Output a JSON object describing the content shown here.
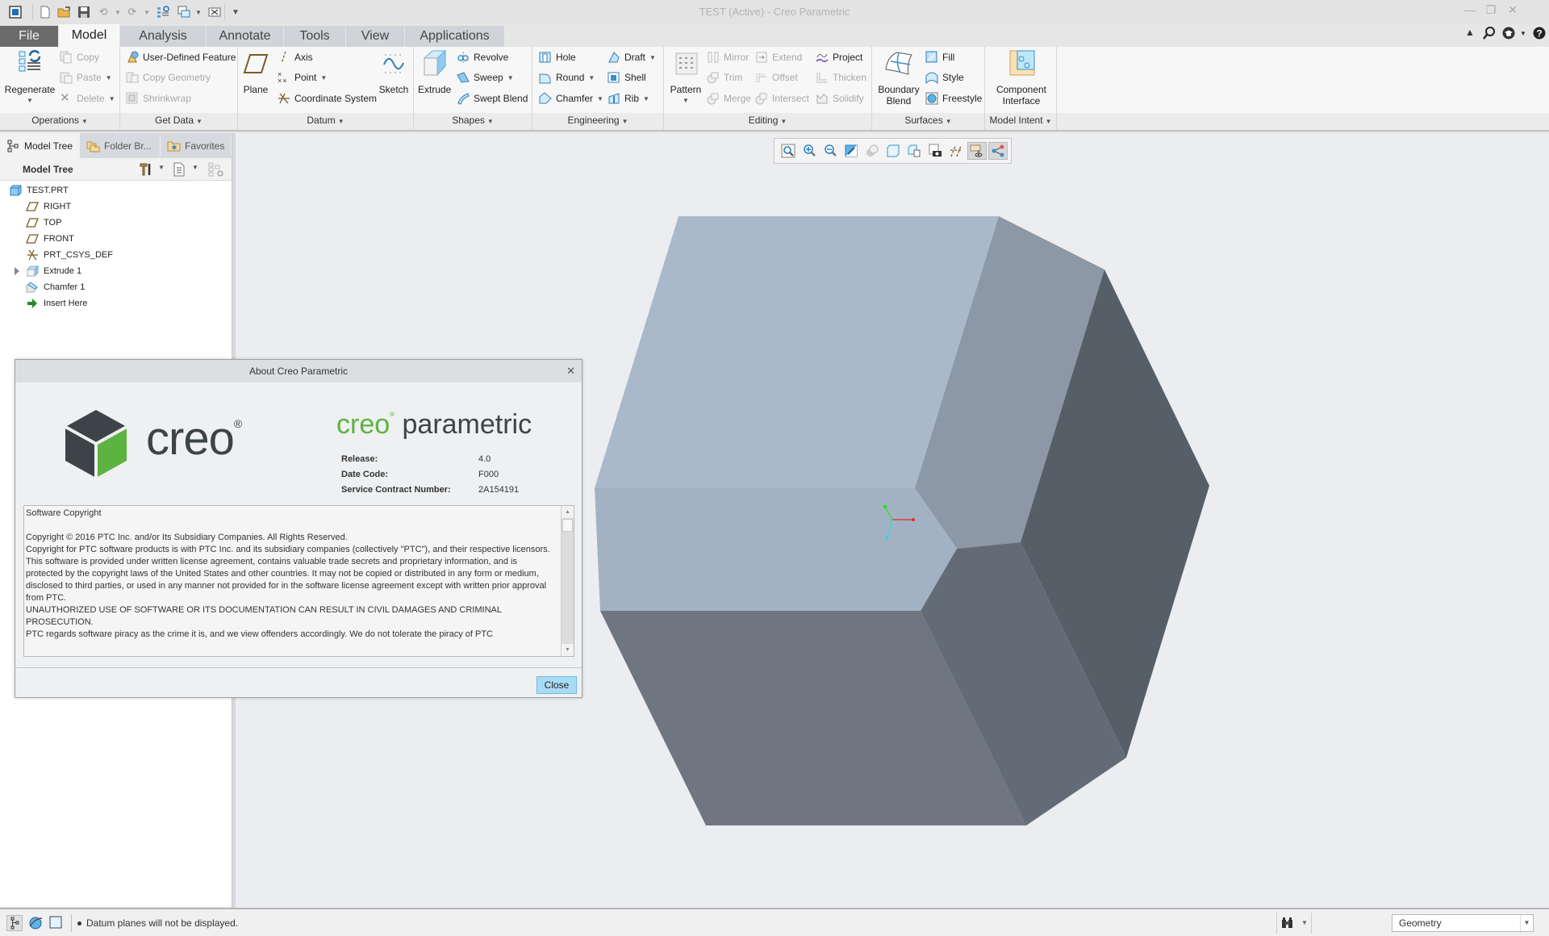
{
  "window": {
    "title": "TEST (Active) - Creo Parametric"
  },
  "quick_access": {
    "icons": [
      "app-menu-icon",
      "new-icon",
      "open-icon",
      "save-icon",
      "undo-icon",
      "redo-icon",
      "regenerate-icon",
      "windows-icon",
      "close-window-icon",
      "customize-icon"
    ]
  },
  "tabs": [
    {
      "label": "File"
    },
    {
      "label": "Model",
      "active": true
    },
    {
      "label": "Analysis"
    },
    {
      "label": "Annotate"
    },
    {
      "label": "Tools"
    },
    {
      "label": "View"
    },
    {
      "label": "Applications"
    }
  ],
  "ribbon": {
    "groups": {
      "operations": {
        "label": "Operations",
        "regenerate": "Regenerate",
        "copy": "Copy",
        "paste": "Paste",
        "delete": "Delete"
      },
      "get_data": {
        "label": "Get Data",
        "udf": "User-Defined Feature",
        "copy_geometry": "Copy Geometry",
        "shrinkwrap": "Shrinkwrap"
      },
      "datum": {
        "label": "Datum",
        "plane": "Plane",
        "axis": "Axis",
        "point": "Point",
        "csys": "Coordinate System",
        "sketch": "Sketch"
      },
      "shapes": {
        "label": "Shapes",
        "extrude": "Extrude",
        "revolve": "Revolve",
        "sweep": "Sweep",
        "swept_blend": "Swept Blend"
      },
      "engineering": {
        "label": "Engineering",
        "hole": "Hole",
        "round": "Round",
        "chamfer": "Chamfer",
        "draft": "Draft",
        "shell": "Shell",
        "rib": "Rib"
      },
      "editing": {
        "label": "Editing",
        "pattern": "Pattern",
        "mirror": "Mirror",
        "trim": "Trim",
        "merge": "Merge",
        "extend": "Extend",
        "offset": "Offset",
        "intersect": "Intersect",
        "project": "Project",
        "thicken": "Thicken",
        "solidify": "Solidify"
      },
      "surfaces": {
        "label": "Surfaces",
        "boundary_blend_1": "Boundary",
        "boundary_blend_2": "Blend",
        "fill": "Fill",
        "style": "Style",
        "freestyle": "Freestyle"
      },
      "model_intent": {
        "label": "Model Intent",
        "component_interface_1": "Component",
        "component_interface_2": "Interface"
      }
    }
  },
  "left_panel": {
    "tabs": [
      {
        "label": "Model Tree",
        "active": true
      },
      {
        "label": "Folder Br..."
      },
      {
        "label": "Favorites"
      }
    ],
    "header": "Model Tree",
    "tree": [
      {
        "label": "TEST.PRT",
        "icon": "part-icon",
        "level": 0
      },
      {
        "label": "RIGHT",
        "icon": "datum-plane-icon",
        "level": 1
      },
      {
        "label": "TOP",
        "icon": "datum-plane-icon",
        "level": 1
      },
      {
        "label": "FRONT",
        "icon": "datum-plane-icon",
        "level": 1
      },
      {
        "label": "PRT_CSYS_DEF",
        "icon": "csys-icon",
        "level": 1
      },
      {
        "label": "Extrude 1",
        "icon": "extrude-icon",
        "level": 1,
        "expandable": true
      },
      {
        "label": "Chamfer 1",
        "icon": "chamfer-icon",
        "level": 1
      },
      {
        "label": "Insert Here",
        "icon": "insert-arrow-icon",
        "level": 1
      }
    ]
  },
  "graphics_toolbar": {
    "buttons": [
      "refit-icon",
      "zoom-in-icon",
      "zoom-out-icon",
      "repaint-icon",
      "display-style-icon",
      "saved-orientations-icon",
      "named-views-icon",
      "view-manager-icon",
      "datum-display-icon",
      "spin-center-icon",
      "annotation-display-icon"
    ]
  },
  "model_colors": {
    "top_face": "#a9b9ca",
    "front_band": "#a3b2c2",
    "upper_right_bevel": "#8c98a6",
    "right_face": "#565e68",
    "lower_right_bevel": "#636b76",
    "bottom_face": "#6f7681",
    "background": "#ebedf0"
  },
  "about_dialog": {
    "title": "About Creo Parametric",
    "logo_text": "creo",
    "product_name_brand": "creo",
    "product_name": "parametric",
    "fields": [
      {
        "label": "Release:",
        "value": "4.0"
      },
      {
        "label": "Date Code:",
        "value": "F000"
      },
      {
        "label": "Service Contract Number:",
        "value": "2A154191"
      }
    ],
    "license_text": "Software Copyright\n\nCopyright © 2016 PTC Inc. and/or Its Subsidiary Companies. All Rights Reserved.\nCopyright for PTC software products is with PTC Inc. and its subsidiary companies (collectively \"PTC\"), and their respective licensors. This software is provided under written license agreement, contains valuable trade secrets and proprietary information, and is protected by the copyright laws of the United States and other countries. It may not be copied or distributed in any form or medium, disclosed to third parties, or used in any manner not provided for in the software license agreement except with written prior approval from PTC.\nUNAUTHORIZED USE OF SOFTWARE OR ITS DOCUMENTATION CAN RESULT IN CIVIL DAMAGES AND CRIMINAL PROSECUTION.\nPTC regards software piracy as the crime it is, and we view offenders accordingly. We do not tolerate the piracy of PTC",
    "close_label": "Close",
    "brand_green": "#5cb33f",
    "brand_dark": "#3d4447"
  },
  "status_bar": {
    "message": "Datum planes will not be displayed.",
    "filter_value": "Geometry"
  }
}
